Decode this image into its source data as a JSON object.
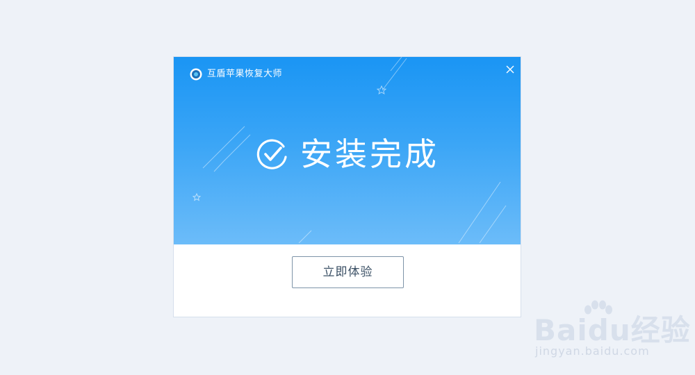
{
  "window": {
    "title": "互盾苹果恢复大师",
    "close_icon": "close-icon",
    "logo_icon": "app-logo-icon"
  },
  "banner": {
    "status_text": "安装完成",
    "status_icon": "check-circle-icon",
    "gradient_top": "#1a95f4",
    "gradient_bottom": "#6cbcf9"
  },
  "footer": {
    "try_button_label": "立即体验"
  },
  "watermark": {
    "brand": "Baidu经验",
    "url": "jingyan.baidu.com"
  }
}
